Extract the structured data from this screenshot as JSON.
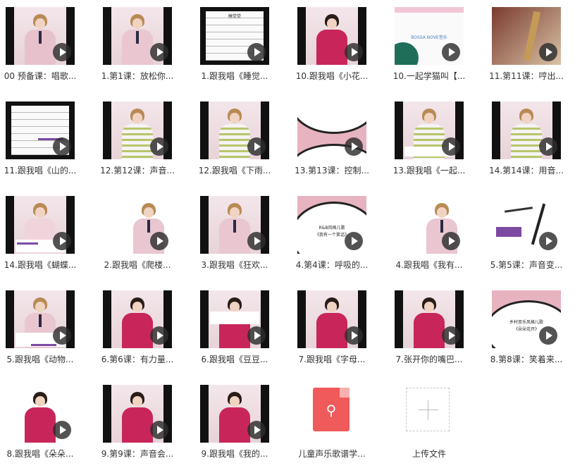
{
  "labels": [
    "00 预备课：唱歌...",
    "1.第1课：放松你...",
    "1.跟我唱《睡觉...",
    "10.跟我唱《小花...",
    "10.一起学猫叫【...",
    "11.第11课：哼出...",
    "11.跟我唱《山的...",
    "12.第12课：声音...",
    "12.跟我唱《下雨...",
    "13.第13课：控制...",
    "13.跟我唱《一起...",
    "14.第14课：用音...",
    "14.跟我唱《蝴蝶...",
    "2.跟我唱《爬楼...",
    "3.跟我唱《狂欢...",
    "4.第4课：呼吸的...",
    "4.跟我唱《我有...",
    "5.第5课：声音变...",
    "5.跟我唱《动物...",
    "6.第6课：有力量...",
    "6.跟我唱《豆豆...",
    "7.跟我唱《字母...",
    "7.张开你的嘴巴...",
    "8.第8课：笑着来...",
    "8.跟我唱《朵朵...",
    "9.第9课：声音会...",
    "9.跟我唱《我的..."
  ],
  "thumb_text": {
    "t2_title": "睡觉觉",
    "t4_title": "BOSSA NOVE音乐",
    "t15_line1": "R&B风格儿歌",
    "t15_line2": "《我有一个笑话》",
    "t23_line1": "乡村音乐风格儿歌",
    "t23_line2": "《朵朵花开》"
  },
  "pdf": {
    "label": "儿童声乐歌谱学...",
    "icon": "pdf-icon"
  },
  "upload": {
    "label": "上传文件",
    "icon": "plus-icon"
  },
  "colors": {
    "play": "#2d2d2d",
    "pdf": "#f05a5a",
    "accent_purple": "#7c4aa3",
    "dress_red": "#c8265a"
  }
}
